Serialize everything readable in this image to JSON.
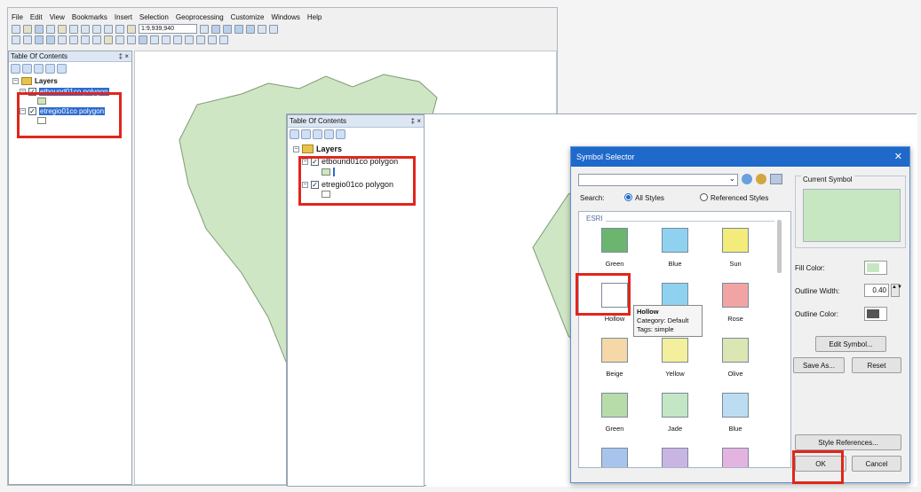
{
  "menu": [
    "File",
    "Edit",
    "View",
    "Bookmarks",
    "Insert",
    "Selection",
    "Geoprocessing",
    "Customize",
    "Windows",
    "Help"
  ],
  "scale": "1:9,939,940",
  "toc1": {
    "title": "Table Of Contents",
    "pin": "‡ ×",
    "group": "Layers",
    "layers": [
      "etbound01co polygon",
      "etregio01co polygon"
    ]
  },
  "toc2": {
    "title": "Table Of Contents",
    "pin": "‡ ×",
    "group": "Layers",
    "layers": [
      "etbound01co polygon",
      "etregio01co polygon"
    ]
  },
  "dialog": {
    "title": "Symbol Selector",
    "close": "✕",
    "search_label": "Search:",
    "radio_all": "All Styles",
    "radio_ref": "Referenced Styles",
    "gallery_header": "ESRI",
    "symbols": [
      {
        "label": "Green",
        "color": "#6bb56f"
      },
      {
        "label": "Blue",
        "color": "#8fd2ef"
      },
      {
        "label": "Sun",
        "color": "#f3ec7a"
      },
      {
        "label": "Hollow",
        "color": "#ffffff"
      },
      {
        "label": "",
        "color": "#8fd2ef"
      },
      {
        "label": "Rose",
        "color": "#f2a4a4"
      },
      {
        "label": "Beige",
        "color": "#f5d7a8"
      },
      {
        "label": "Yellow",
        "color": "#f4ef9c"
      },
      {
        "label": "Olive",
        "color": "#dbe6b2"
      },
      {
        "label": "Green",
        "color": "#b7dca9"
      },
      {
        "label": "Jade",
        "color": "#c3e6c4"
      },
      {
        "label": "Blue",
        "color": "#bcdcf1"
      },
      {
        "label": "",
        "color": "#a9c4ec"
      },
      {
        "label": "",
        "color": "#c9b5e2"
      },
      {
        "label": "",
        "color": "#e3b4e0"
      }
    ],
    "tooltip": {
      "name": "Hollow",
      "category": "Category: Default",
      "tags": "Tags: simple"
    },
    "current_symbol_label": "Current Symbol",
    "current_symbol_color": "#c7e7c2",
    "fill_color_label": "Fill Color:",
    "fill_color": "#c7e7c2",
    "outline_width_label": "Outline Width:",
    "outline_width": "0.40",
    "outline_color_label": "Outline Color:",
    "outline_color": "#555555",
    "edit_symbol": "Edit Symbol...",
    "save_as": "Save As...",
    "reset": "Reset",
    "style_refs": "Style References...",
    "ok": "OK",
    "cancel": "Cancel"
  },
  "colors": {
    "map_fill": "#cfe6c5",
    "map_stroke": "#7e9a76",
    "highlight": "#e0261c",
    "title_bar": "#1e69c9"
  }
}
